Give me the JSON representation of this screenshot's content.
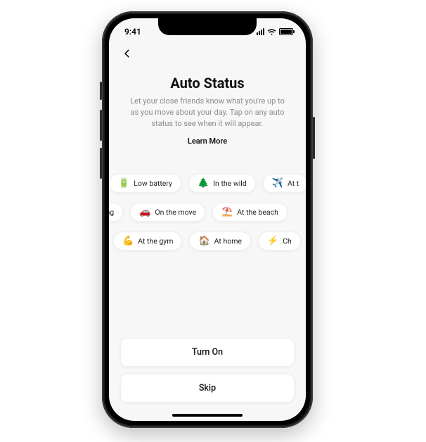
{
  "status_bar": {
    "time": "9:41"
  },
  "nav": {
    "back_name": "back-icon"
  },
  "header": {
    "title": "Auto Status",
    "subtitle": "Let your close friends know what you're up to as you move about your day. Tap on any auto status to see when it will appear.",
    "learn_more": "Learn More"
  },
  "chip_rows": [
    [
      {
        "icon": "🔋",
        "icon_name": "low-battery-icon",
        "label": "Low battery"
      },
      {
        "icon": "🌲",
        "icon_name": "tree-icon",
        "label": "In the wild"
      },
      {
        "icon": "✈️",
        "icon_name": "airplane-icon",
        "label": "At t"
      }
    ],
    [
      {
        "icon": "",
        "icon_name": "",
        "label": "ping"
      },
      {
        "icon": "🚗",
        "icon_name": "car-icon",
        "label": "On the move"
      },
      {
        "icon": "⛱️",
        "icon_name": "beach-umbrella-icon",
        "label": "At the beach"
      }
    ],
    [
      {
        "icon": "💪",
        "icon_name": "flexed-biceps-icon",
        "label": "At the gym"
      },
      {
        "icon": "🏠",
        "icon_name": "house-icon",
        "label": "At home"
      },
      {
        "icon": "⚡",
        "icon_name": "lightning-icon",
        "label": "Ch"
      }
    ]
  ],
  "buttons": {
    "turn_on": "Turn On",
    "skip": "Skip"
  }
}
